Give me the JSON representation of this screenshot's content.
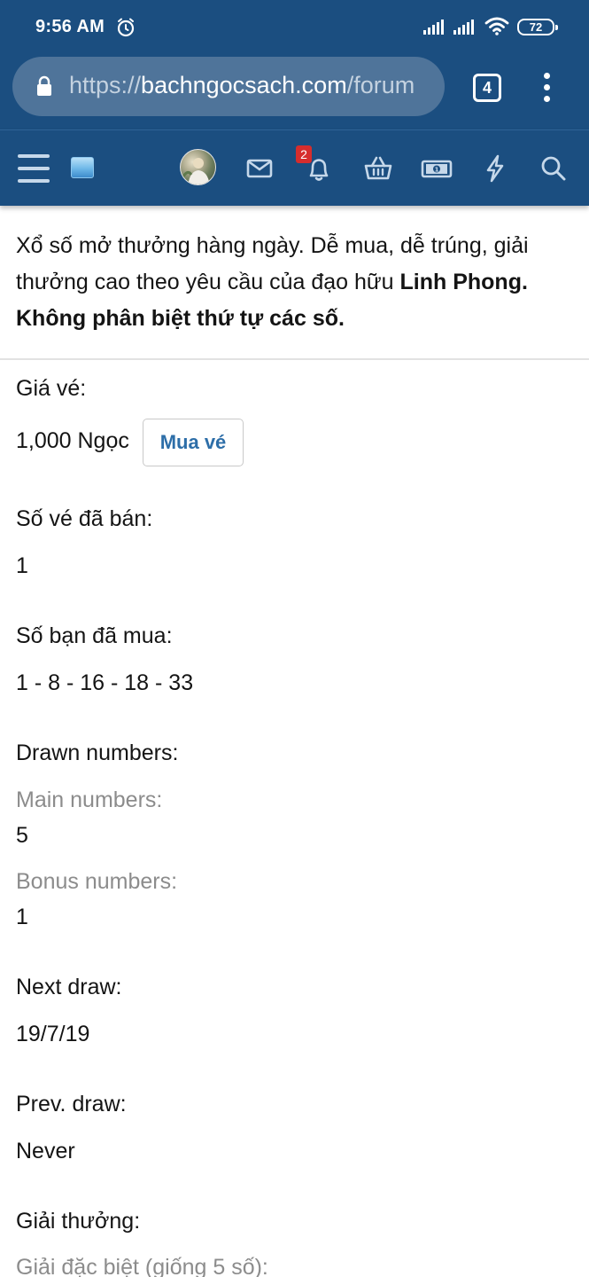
{
  "status_bar": {
    "time": "9:56 AM",
    "battery": "72",
    "icons": [
      "alarm-icon",
      "signal-icon",
      "signal-icon",
      "wifi-icon",
      "battery-icon"
    ]
  },
  "browser": {
    "url_scheme": "https://",
    "url_host": "bachngocsach.com",
    "url_path": "/forum",
    "tab_count": "4",
    "icons": [
      "lock-icon",
      "more-vert-icon"
    ]
  },
  "site_nav": {
    "notification_count": "2",
    "icons": [
      "hamburger-icon",
      "site-logo-icon",
      "avatar",
      "mail-icon",
      "bell-icon",
      "basket-icon",
      "money-icon",
      "lightning-icon",
      "search-icon"
    ]
  },
  "intro": {
    "text": "Xổ số mở thưởng hàng ngày. Dễ mua, dễ trúng, giải thưởng cao theo yêu cầu của đạo hữu ",
    "bold": "Linh Phong. Không phân biệt thứ tự các số."
  },
  "ticket": {
    "price_label": "Giá vé:",
    "price_value": "1,000 Ngọc",
    "buy_label": "Mua vé",
    "sold_label": "Số vé đã bán:",
    "sold_value": "1",
    "bought_label": "Số bạn đã mua:",
    "bought_value": "1 - 8 - 16 - 18 - 33",
    "drawn_label": "Drawn numbers:",
    "main_label": "Main numbers:",
    "main_value": "5",
    "bonus_label": "Bonus numbers:",
    "bonus_value": "1",
    "next_label": "Next draw:",
    "next_value": "19/7/19",
    "prev_label": "Prev. draw:",
    "prev_value": "Never",
    "prize_label": "Giải thưởng:",
    "special_label": "Giải đặc biệt (giống 5 số):"
  }
}
